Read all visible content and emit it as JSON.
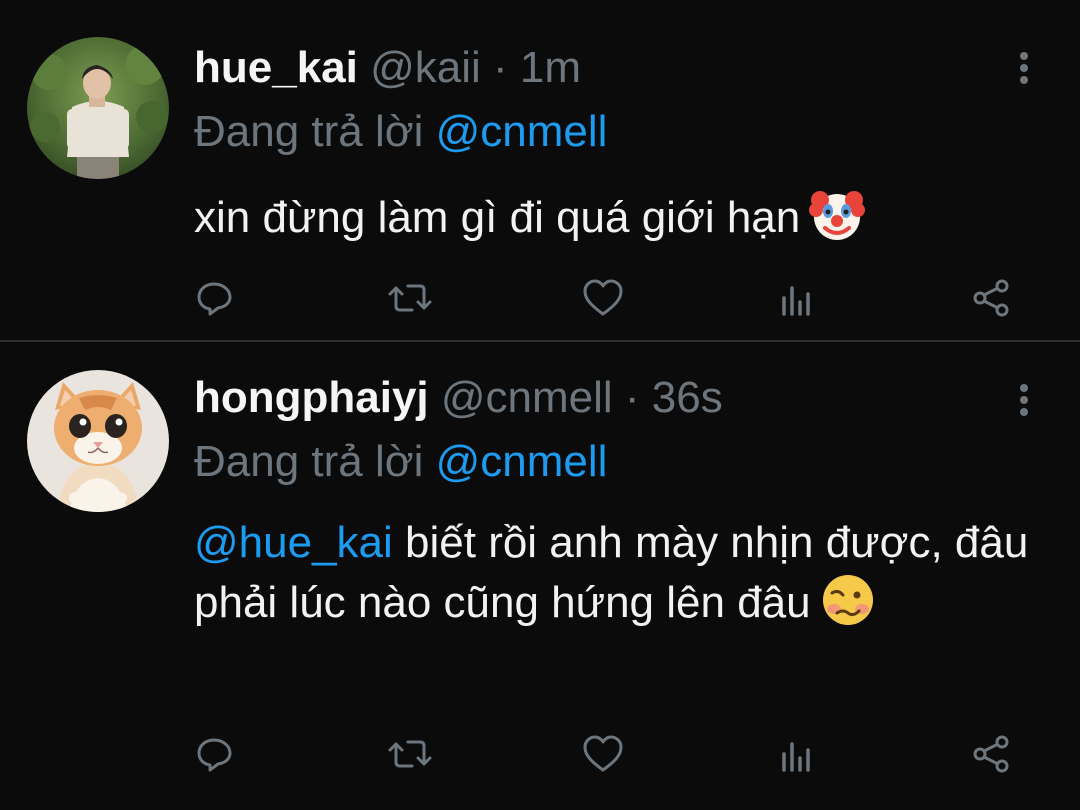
{
  "tweets": [
    {
      "display_name": "hue_kai",
      "handle_time": "@kaii · 1m",
      "reply_label": "Đang trả lời",
      "reply_to": "@cnmell",
      "mention": "",
      "text": "xin đừng làm gì đi quá giới hạn",
      "emoji": "clown-face-icon",
      "avatar": "avatar-photo-person-outdoors"
    },
    {
      "display_name": "hongphaiyj",
      "handle_time": "@cnmell · 36s",
      "reply_label": "Đang trả lời",
      "reply_to": "@cnmell",
      "mention": "@hue_kai",
      "text": " biết rồi anh mày nhịn được, đâu phải lúc nào cũng hứng lên đâu",
      "emoji": "woozy-face-icon",
      "avatar": "avatar-photo-orange-kitten"
    }
  ],
  "icons": {
    "actions": [
      "reply-icon",
      "retweet-icon",
      "like-icon",
      "stats-icon",
      "share-icon"
    ],
    "more": "more-vertical-icon"
  },
  "colors": {
    "background": "#0b0b0b",
    "text": "#f2f2f2",
    "muted": "#6e767d",
    "link": "#1d9bf0",
    "divider": "#2a2d30"
  }
}
